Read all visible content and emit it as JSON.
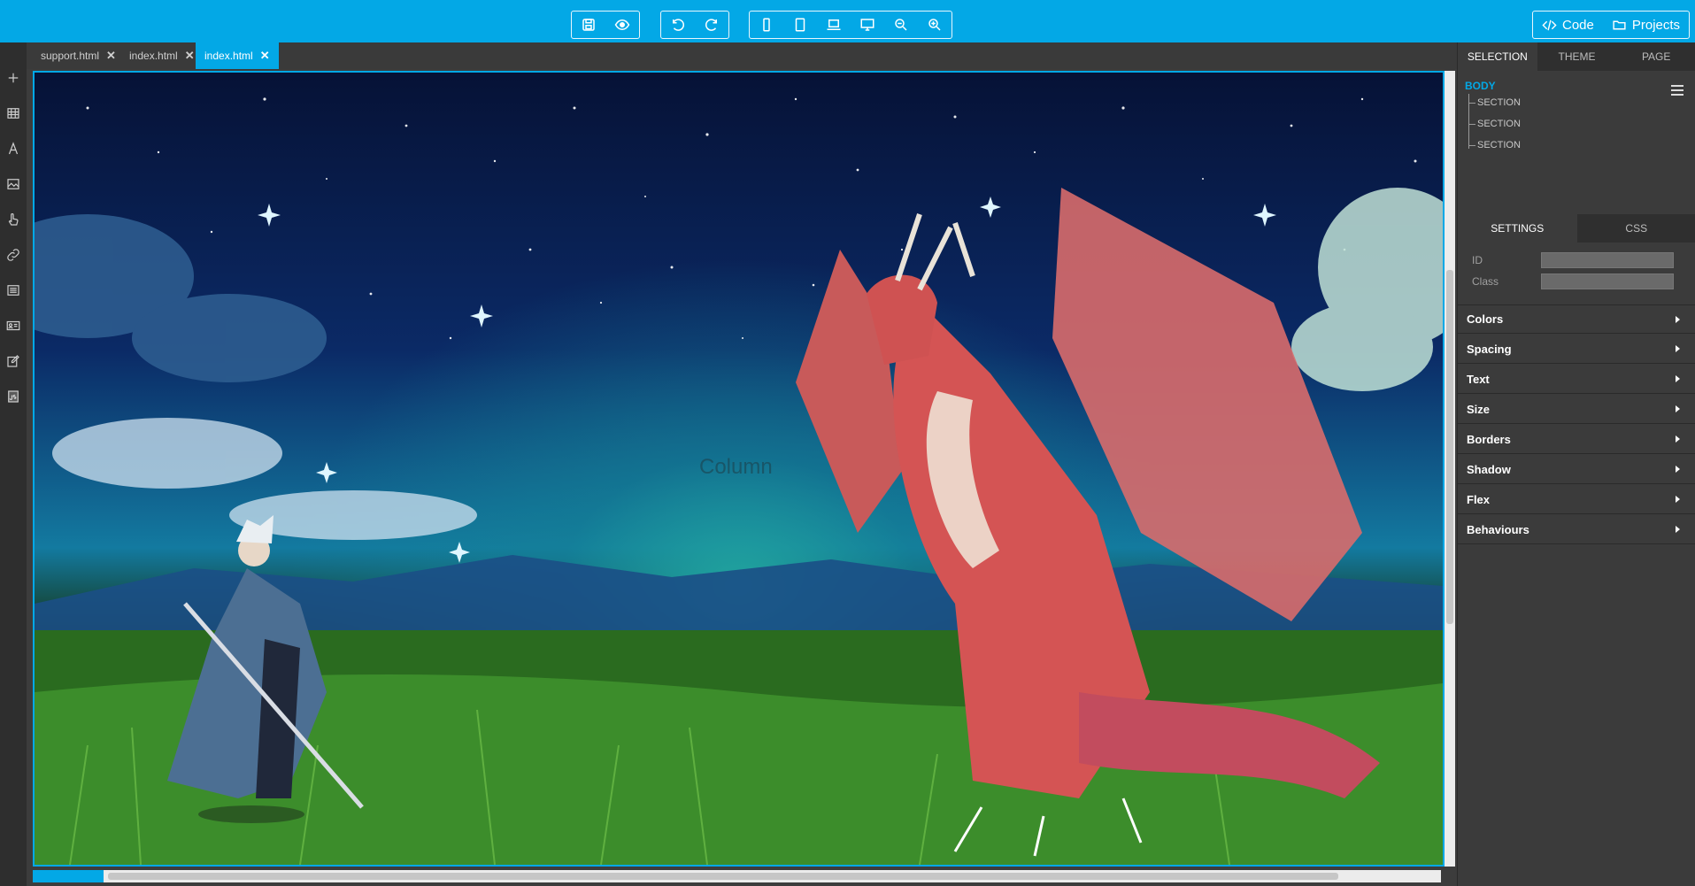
{
  "toolbar": {
    "groups": [
      [
        "save-icon",
        "preview-eye-icon"
      ],
      [
        "undo-icon",
        "redo-icon"
      ],
      [
        "mobile-icon",
        "tablet-icon",
        "laptop-icon",
        "desktop-icon",
        "zoom-out-icon",
        "zoom-in-icon"
      ]
    ],
    "code_label": "Code",
    "projects_label": "Projects"
  },
  "sidebar_tools": [
    "add-icon",
    "table-icon",
    "text-icon",
    "image-icon",
    "hand-pointer-icon",
    "link-icon",
    "list-icon",
    "id-card-icon",
    "edit-icon",
    "js-file-icon"
  ],
  "file_tabs": [
    {
      "label": "support.html",
      "active": false
    },
    {
      "label": "index.html",
      "active": false
    },
    {
      "label": "index.html",
      "active": true
    }
  ],
  "canvas": {
    "watermark": "Column",
    "image_description": "Fantasy artwork: a starry night sky over a grassy plain, a white-haired swordsman in a blue coat on the left and a large red dragon on the right"
  },
  "right_panel": {
    "tabs": [
      {
        "label": "SELECTION",
        "active": true
      },
      {
        "label": "THEME",
        "active": false
      },
      {
        "label": "PAGE",
        "active": false
      }
    ],
    "tree": {
      "root": "BODY",
      "children": [
        "SECTION",
        "SECTION",
        "SECTION"
      ]
    },
    "settings_tabs": [
      {
        "label": "SETTINGS",
        "active": true
      },
      {
        "label": "CSS",
        "active": false
      }
    ],
    "fields": [
      {
        "label": "ID",
        "value": ""
      },
      {
        "label": "Class",
        "value": ""
      }
    ],
    "sections": [
      "Colors",
      "Spacing",
      "Text",
      "Size",
      "Borders",
      "Shadow",
      "Flex",
      "Behaviours"
    ]
  }
}
